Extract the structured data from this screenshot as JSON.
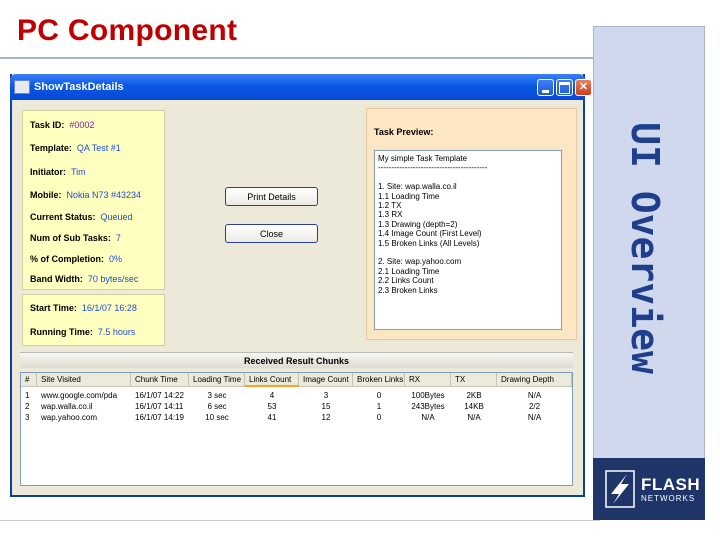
{
  "slide": {
    "title": "PC Component",
    "side_caption": "UI Overview",
    "logo": {
      "brand": "FLASH",
      "sub": "NETWORKS",
      "icon": "flash-networks-logo-icon"
    }
  },
  "window": {
    "title": "ShowTaskDetails",
    "icons": {
      "app": "app-icon",
      "minimize": "minimize-icon",
      "maximize": "maximize-icon",
      "close": "close-icon"
    }
  },
  "info": [
    {
      "label": "Task ID:",
      "value": "#0002"
    },
    {
      "label": "Template:",
      "value": "QA Test #1"
    },
    {
      "label": "Initiator:",
      "value": "Tim"
    },
    {
      "label": "Mobile:",
      "value": "Nokia N73 #43234"
    },
    {
      "label": "Current Status:",
      "value": "Queued"
    },
    {
      "label": "Num of Sub Tasks:",
      "value": "7"
    },
    {
      "label": "% of Completion:",
      "value": "0%"
    },
    {
      "label": "Band Width:",
      "value": "70 bytes/sec"
    }
  ],
  "timing": [
    {
      "label": "Start Time:",
      "value": "16/1/07 16:28"
    },
    {
      "label": "Running Time:",
      "value": "7.5 hours"
    }
  ],
  "buttons": {
    "print": "Print Details",
    "close": "Close"
  },
  "preview": {
    "label": "Task Preview:",
    "lines": [
      "My simple Task Template",
      "-----------------------------------------",
      "",
      "1. Site: wap.walla.co.il",
      "    1.1 Loading Time",
      "    1.2 TX",
      "    1.3 RX",
      "    1.3 Drawing (depth=2)",
      "    1.4 Image Count (First Level)",
      "    1.5 Broken Links (All Levels)",
      "",
      "2. Site: wap.yahoo.com",
      "    2.1 Loading Time",
      "    2.2 Links Count",
      "    2.3 Broken Links"
    ]
  },
  "results": {
    "header": "Received Result Chunks",
    "columns": [
      "#",
      "Site Visited",
      "Chunk Time",
      "Loading Time",
      "Links Count",
      "Image Count",
      "Broken Links",
      "RX",
      "TX",
      "Drawing Depth"
    ],
    "rows": [
      [
        "1",
        "www.google.com/pda",
        "16/1/07 14:22",
        "3 sec",
        "4",
        "3",
        "0",
        "100Bytes",
        "2KB",
        "N/A"
      ],
      [
        "2",
        "wap.walla.co.il",
        "16/1/07 14:11",
        "6 sec",
        "53",
        "15",
        "1",
        "243Bytes",
        "14KB",
        "2/2"
      ],
      [
        "3",
        "wap.yahoo.com",
        "16/1/07 14:19",
        "10 sec",
        "41",
        "12",
        "0",
        "N/A",
        "N/A",
        "N/A"
      ]
    ]
  }
}
